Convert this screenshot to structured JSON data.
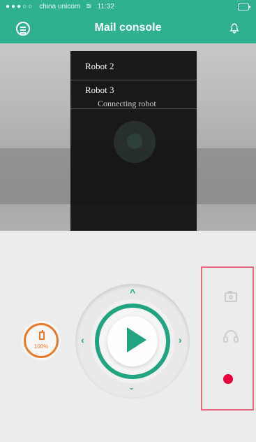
{
  "status_bar": {
    "carrier": "china unicom",
    "time": "11:32"
  },
  "header": {
    "title": "Mail console"
  },
  "robot_list": {
    "items": [
      {
        "label": "Robot 2"
      },
      {
        "label": "Robot 3",
        "status": "Connecting robot"
      }
    ]
  },
  "battery": {
    "percent_label": "100%",
    "percent": 100,
    "color": "#e87a2b"
  },
  "controls": {
    "accent_color": "#22a482"
  },
  "side_panel": {
    "border_color": "#e66b7d",
    "record_color": "#e8003d"
  }
}
